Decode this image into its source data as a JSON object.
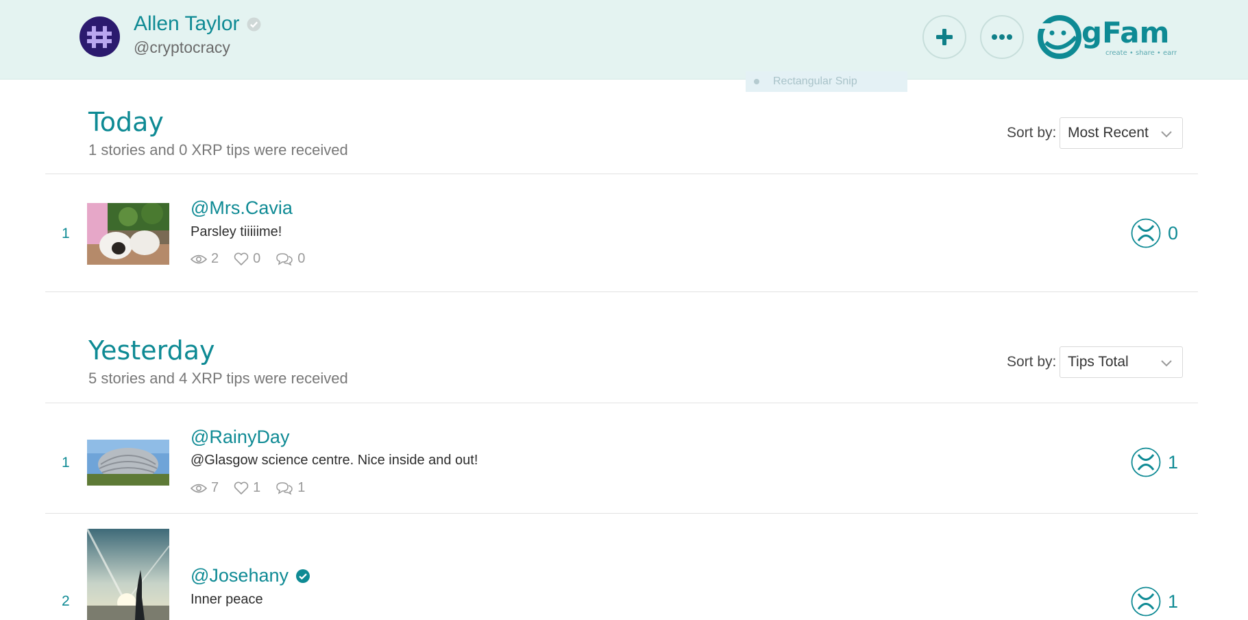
{
  "header": {
    "user_name": "Allen Taylor",
    "user_handle": "@cryptocracy",
    "logo_text": "gFam",
    "logo_tagline": "create • share • earn",
    "overlay_label": "Rectangular Snip"
  },
  "colors": {
    "accent": "#0e8a94",
    "header_bg": "#e4f3f1",
    "avatar_bg": "#2b1a6e"
  },
  "sections": [
    {
      "title": "Today",
      "subtitle": "1 stories and 0 XRP tips were received",
      "sort_label": "Sort by:",
      "sort_value": "Most Recent",
      "rows": [
        {
          "rank": "1",
          "author": "@Mrs.Cavia",
          "story": "Parsley tiiiiime!",
          "views": "2",
          "likes": "0",
          "comments": "0",
          "tips": "0"
        }
      ]
    },
    {
      "title": "Yesterday",
      "subtitle": "5 stories and 4 XRP tips were received",
      "sort_label": "Sort by:",
      "sort_value": "Tips Total",
      "rows": [
        {
          "rank": "1",
          "author": "@RainyDay",
          "story": "@Glasgow science centre. Nice inside and out!",
          "views": "7",
          "likes": "1",
          "comments": "1",
          "tips": "1"
        },
        {
          "rank": "2",
          "author": "@Josehany",
          "story": "Inner peace",
          "tips": "1"
        }
      ]
    }
  ]
}
